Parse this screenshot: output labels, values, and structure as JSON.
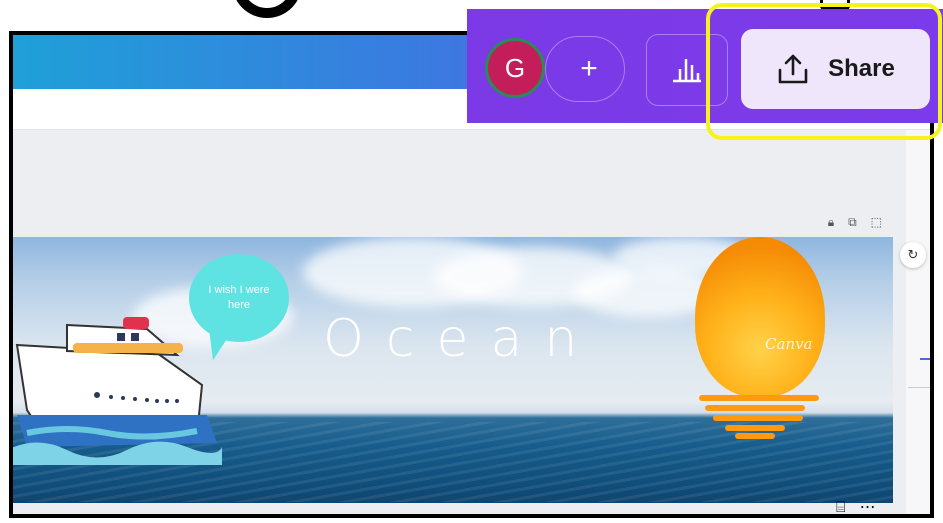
{
  "header": {
    "avatar_initial": "G",
    "add_collaborator_label": "+",
    "share_label": "Share"
  },
  "page_controls": {
    "lock_icon": "lock-icon",
    "duplicate_icon": "duplicate-icon",
    "add_page_icon": "add-page-icon",
    "refresh_icon": "magic-refresh-icon"
  },
  "design": {
    "title": "Ocean",
    "bubble_text": "I wish I were here",
    "watermark": "Canva"
  },
  "colors": {
    "share_panel": "#7b3ae6",
    "share_button": "#efe6fb",
    "highlight": "#f5f21d",
    "avatar": "#c31e59"
  }
}
